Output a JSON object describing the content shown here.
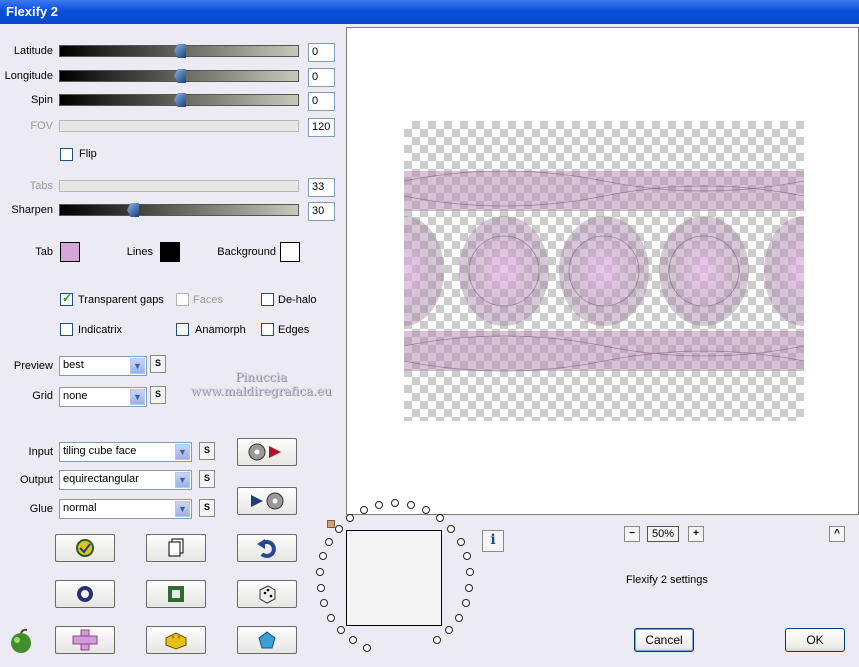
{
  "window": {
    "title": "Flexify 2"
  },
  "sliders": {
    "latitude": {
      "label": "Latitude",
      "value": "0"
    },
    "longitude": {
      "label": "Longitude",
      "value": "0"
    },
    "spin": {
      "label": "Spin",
      "value": "0"
    },
    "fov": {
      "label": "FOV",
      "value": "120"
    },
    "tabs": {
      "label": "Tabs",
      "value": "33"
    },
    "sharpen": {
      "label": "Sharpen",
      "value": "30"
    }
  },
  "flip": {
    "label": "Flip",
    "checked": false
  },
  "colors": {
    "tab": {
      "label": "Tab",
      "color": "#d7a6d8"
    },
    "lines": {
      "label": "Lines",
      "color": "#000000"
    },
    "background": {
      "label": "Background",
      "color": "#ffffff"
    }
  },
  "options": {
    "transparent_gaps": {
      "label": "Transparent gaps",
      "checked": true
    },
    "faces": {
      "label": "Faces",
      "checked": false
    },
    "de_halo": {
      "label": "De-halo",
      "checked": false
    },
    "indicatrix": {
      "label": "Indicatrix",
      "checked": false
    },
    "anamorph": {
      "label": "Anamorph",
      "checked": false
    },
    "edges": {
      "label": "Edges",
      "checked": false
    }
  },
  "selects": {
    "preview": {
      "label": "Preview",
      "value": "best"
    },
    "grid": {
      "label": "Grid",
      "value": "none"
    },
    "input": {
      "label": "Input",
      "value": "tiling cube face"
    },
    "output": {
      "label": "Output",
      "value": "equirectangular"
    },
    "glue": {
      "label": "Glue",
      "value": "normal"
    }
  },
  "small_button": {
    "label": "S"
  },
  "zoom": {
    "minus": "−",
    "value": "50%",
    "plus": "+"
  },
  "status_text": "Flexify 2 settings",
  "up_button": "^",
  "info_button": "i",
  "buttons": {
    "cancel": "Cancel",
    "ok": "OK"
  },
  "watermark": {
    "line1": "Pinuccia",
    "line2": "www.maldiregrafica.eu"
  },
  "icons": [
    "apply-icon",
    "copy-icon",
    "undo-icon",
    "ring-icon",
    "square-icon",
    "dice-icon",
    "cross-icon",
    "block-icon",
    "gem-icon",
    "apple-logo-icon",
    "disc-play-icon",
    "play-disc-icon"
  ]
}
